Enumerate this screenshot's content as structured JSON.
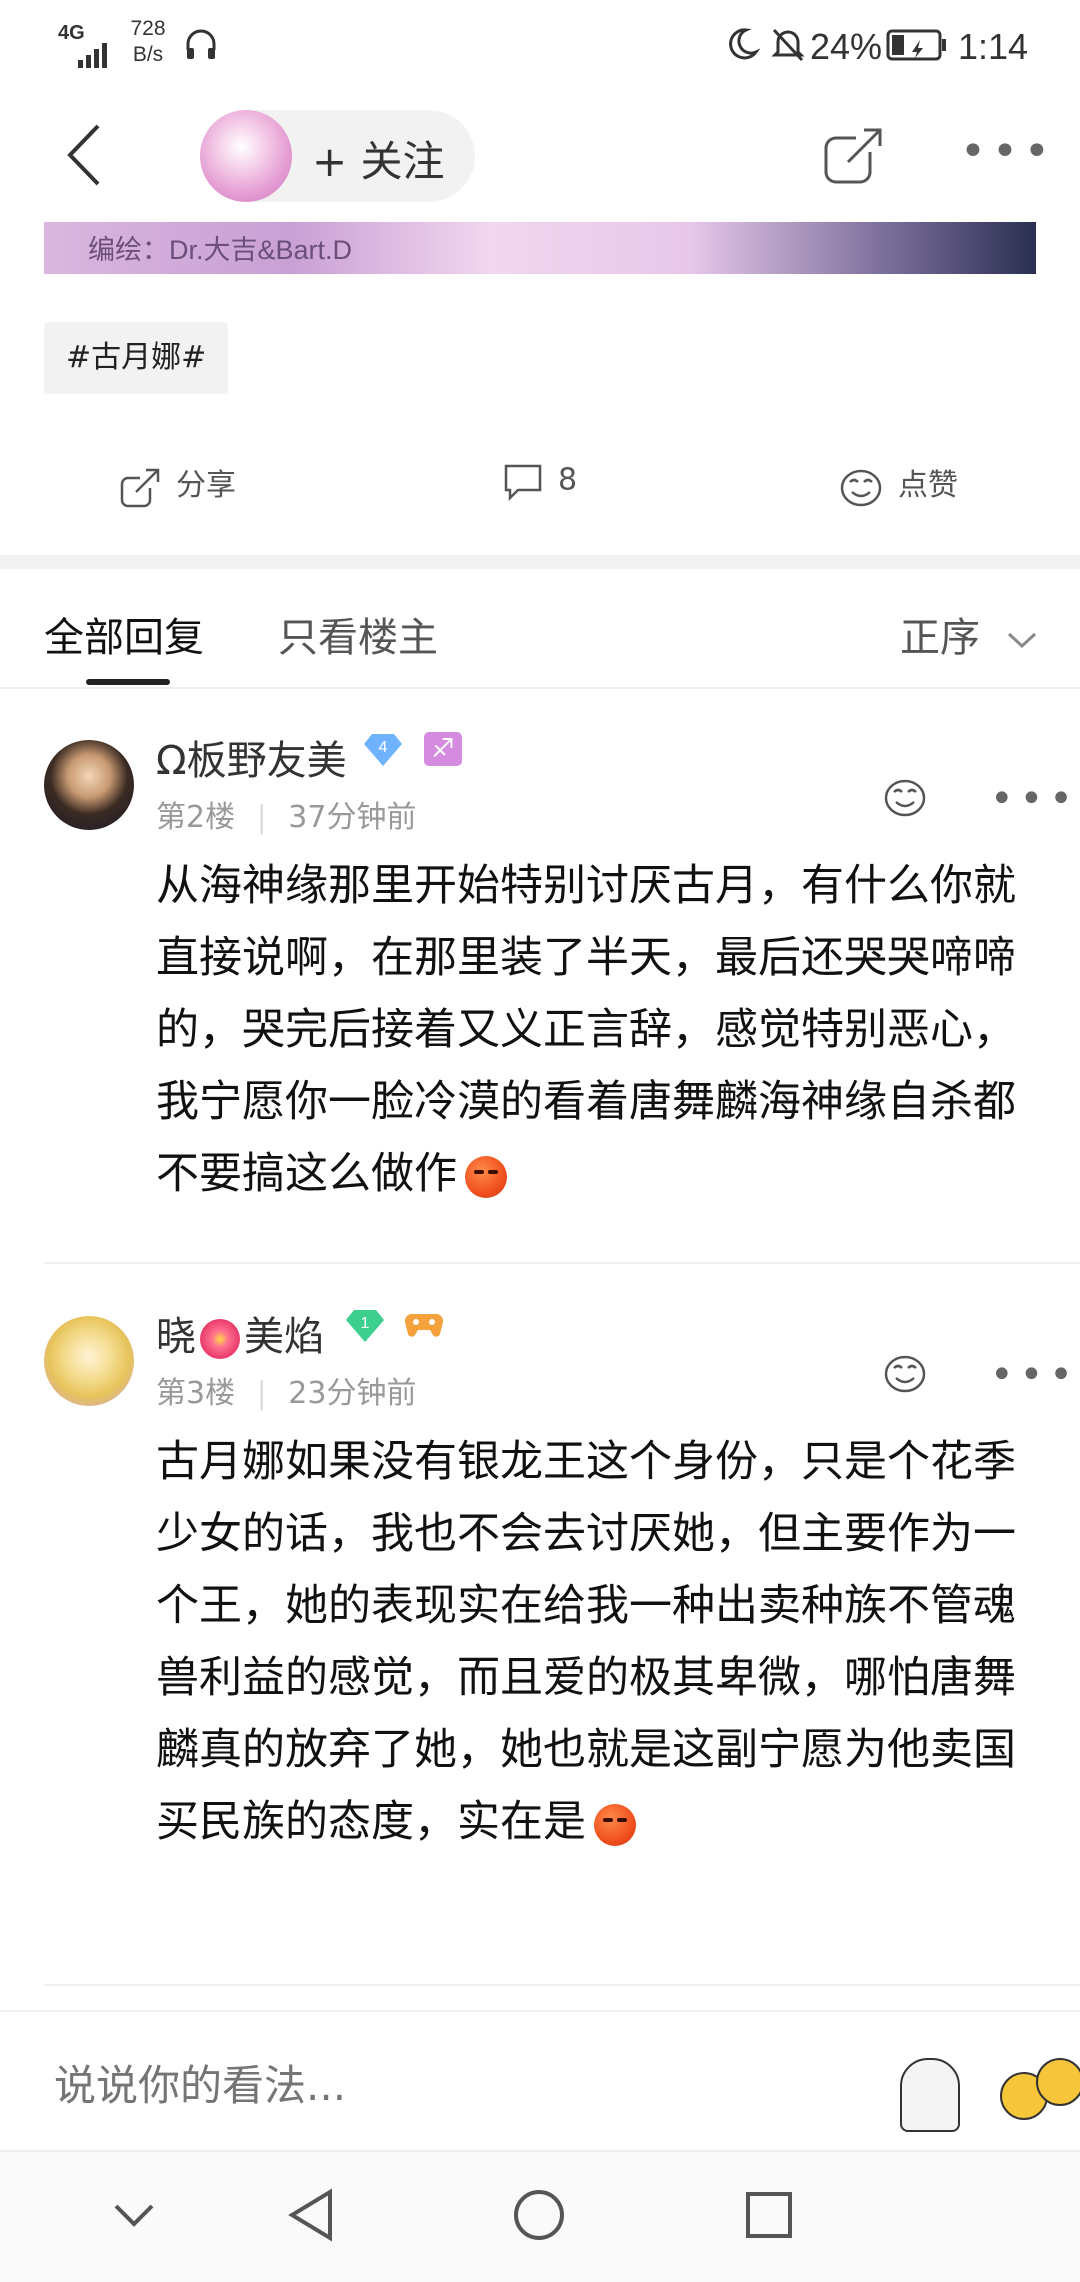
{
  "status_bar": {
    "signal": "4G",
    "speed_value": "728",
    "speed_unit": "B/s",
    "battery": "24%",
    "time": "1:14"
  },
  "nav": {
    "follow_label": "+ 关注"
  },
  "banner": {
    "caption": "编绘：Dr.大吉&Bart.D"
  },
  "post": {
    "tag": "#古月娜#",
    "share_label": "分享",
    "comment_count": "8",
    "like_label": "点赞"
  },
  "tabs": {
    "all_replies": "全部回复",
    "op_only": "只看楼主",
    "sort": "正序"
  },
  "comments": [
    {
      "username": "Ω板野友美",
      "level": "4",
      "floor": "第2楼",
      "time": "37分钟前",
      "text": "从海神缘那里开始特别讨厌古月，有什么你就直接说啊，在那里装了半天，最后还哭哭啼啼的，哭完后接着又义正言辞，感觉特别恶心，我宁愿你一脸冷漠的看着唐舞麟海神缘自杀都不要搞这么做作"
    },
    {
      "username_a": "晓",
      "username_b": "美焰",
      "level": "1",
      "floor": "第3楼",
      "time": "23分钟前",
      "text": "古月娜如果没有银龙王这个身份，只是个花季少女的话，我也不会去讨厌她，但主要作为一个王，她的表现实在给我一种出卖种族不管魂兽利益的感觉，而且爱的极其卑微，哪怕唐舞麟真的放弃了她，她也就是这副宁愿为他卖国买民族的态度，实在是"
    }
  ],
  "input": {
    "placeholder": "说说你的看法..."
  },
  "colors": {
    "gem_blue": "#6fb3ff",
    "gem_green": "#3ccf8e",
    "badge_purple": "#d58be0",
    "emoji_red": "#f0501e"
  }
}
